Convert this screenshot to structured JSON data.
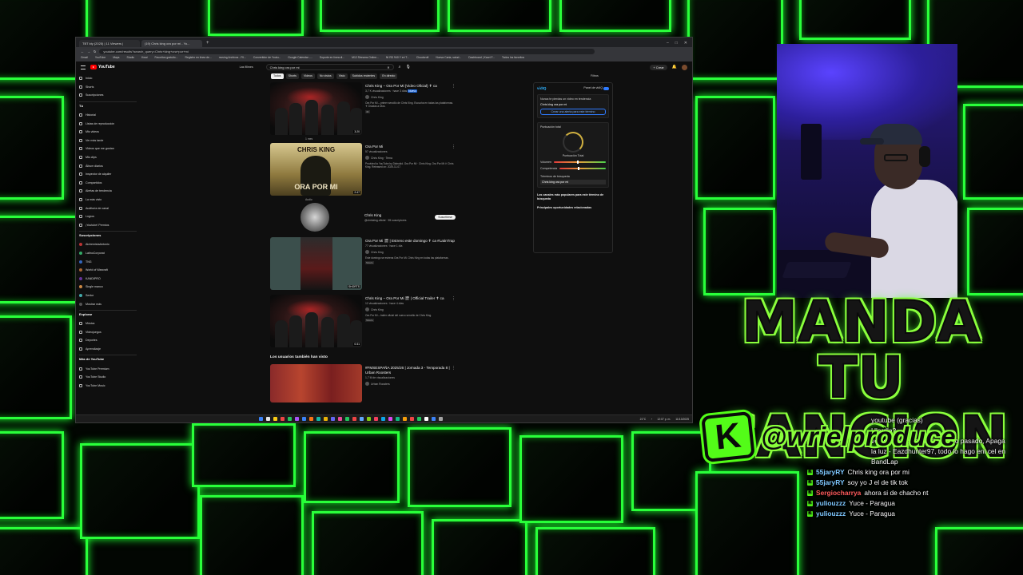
{
  "browser": {
    "tabs": [
      "TBT kty (2025) | 11 Viewers |",
      "(19) Chris king ora por mi - Yo..."
    ],
    "url": "youtube.com/results?search_query=Chris+king+ora+por+mi",
    "bookmarks": [
      "Gmail",
      "YouTube",
      "Maps",
      "Studio",
      "Kwai",
      "Favoritos gratuito...",
      "Registro en línea de...",
      "moving Archivos - Fil...",
      "Convertidor de Youtu...",
      "Google Calendar -...",
      "Soporte en línea di...",
      "M12 Streams Online...",
      "NI RD 940 Y eri T...",
      "Cloudcroft",
      "Nueva Carta, salud...",
      "Dashboard | Kaori F...",
      "Todos los favoritos"
    ]
  },
  "youtube": {
    "logo": "YouTube",
    "search_value": "Chris king ora por mi",
    "search_mode": "Las fillmes",
    "create": "+ Crear",
    "chips": [
      "Todos",
      "Shorts",
      "Videos",
      "No vistos",
      "Visto",
      "Subidos recientes",
      "En directo"
    ],
    "filters": "Filtros",
    "sidebar": {
      "main": [
        "Inicio",
        "Shorts",
        "Suscripciones"
      ],
      "you_header": "Tú",
      "you": [
        "Historial",
        "Listas de reproducción",
        "Mis videos",
        "Ver más tarde",
        "Videos que me gustan",
        "Mis clips",
        "Álbum diarios",
        "Inspector de alquiler",
        "Compartidos",
        "Alertas de tendencia",
        "La más visto",
        "Auditoría de canal",
        "Logros",
        "¡Youtube! Premios"
      ],
      "subs_header": "Suscripciones",
      "subs": [
        "AlchemistaAntonio",
        "LatinoCorporat",
        "TNG",
        "World of Warcraft",
        "KANDIPRO",
        "Single manco",
        "Senke",
        "Mostrar más"
      ],
      "explore_header": "Explorar",
      "explore": [
        "Música",
        "Videojuegos",
        "Deportes",
        "Aprendizaje"
      ],
      "more_header": "Más de YouTube",
      "more": [
        "YouTube Premium",
        "YouTube Studio",
        "YouTube Music"
      ]
    },
    "results": [
      {
        "title": "Chris King – Ora Por Mi (Video Oficial) ✝ ca",
        "meta": "3,7 K visualizaciones · hace 3 días",
        "new": "Nuevo",
        "channel": "Chris King",
        "desc": "Ora Por Mi – primer sencillo de Chris King. Escucha en todas las plataformas. ✝ Gracias a Dios.",
        "badge": "4K",
        "duration": "3:20",
        "under": "1 mes"
      },
      {
        "title": "Ora Por Mi",
        "meta": "57 visualizaciones",
        "channel": "Chris King · Tema",
        "desc": "Provided to YouTube by Distrokid. Ora Por Mi · Chris King. Ora Por Mi ℗ Chris King. Released on: 2025-11-07.",
        "duration": "2:47",
        "under": "Audio"
      },
      {
        "channel_name": "Chris King",
        "channel_meta": "@chrisking.oficial · 55 suscriptores",
        "subscribe": "Suscribirse"
      },
      {
        "title": "Ora Por Mi 🎬 | Estreno este domingo ✝ ca #LatinTrap",
        "meta": "77 visualizaciones · hace 1 día",
        "channel": "Chris King",
        "desc": "Este domingo se estrena Ora Por Mi. Chris King en todas las plataformas.",
        "badge": "Shorts",
        "duration": "SHORTS"
      },
      {
        "title": "Chris King – Ora Por Mi 🎬 | Official Trailer ✝ ca",
        "meta": "12 visualizaciones · hace 4 días",
        "channel": "Chris King",
        "desc": "Ora Por Mi – trailer oficial del nuevo sencillo de Chris King.",
        "badge": "Shorts",
        "duration": "0:31"
      }
    ],
    "section2": "Los usuarios también han visto",
    "result6": {
      "title": "#FMSESPAÑA 2025/26 | Jornada 3 - Temporada 8 | Urban Roosters",
      "meta": "1,7 M de visualizaciones",
      "channel": "Urban Roosters"
    }
  },
  "vidiq": {
    "logo": "vidIQ",
    "panel_label": "Panel de vidIQ",
    "trend_q": "Nunca te pierdas un video en tendencia",
    "keyword": "Chris king ora por mi",
    "alert_btn": "Crear una alerta para este término",
    "score_label": "Puntuación total",
    "score_center": "Puntuación Total",
    "volume": "Volumen",
    "competition": "Competencia",
    "terms_label": "Términos de búsqueda",
    "term_selected": "Chris king ora por mi",
    "popular": "Los canales más populares para este término de búsqueda",
    "opportunities": "Principales oportunidades relacionadas"
  },
  "taskbar": {
    "temp": "21°C",
    "time": "12:07 p. m.",
    "date": "11/13/2025"
  },
  "overlay": {
    "title_line1": "MANDA TU",
    "title_line2": "CANCION",
    "k_letter": "K",
    "handle": "@wrielproduce"
  },
  "chat": {
    "continued": [
      "youtube (gracias)",
      "Hlardla?"
    ],
    "continued_long": "voy empezando desde el año pasado, Apaga la luz - Eazdhunter97, todo lo hago eni cel en BandLap",
    "messages": [
      {
        "user": "55jaryRY",
        "color": "#7ec9ff",
        "text": "Chris king ora por mi"
      },
      {
        "user": "55jaryRY",
        "color": "#7ec9ff",
        "text": "soy yo J el de tik tok"
      },
      {
        "user": "Sergiocharrya",
        "color": "#ff5b5b",
        "text": "ahora si de chacho nt"
      },
      {
        "user": "yuliouzzz",
        "color": "#7ec9ff",
        "text": "Yuce - Paragua"
      },
      {
        "user": "yuliouzzz",
        "color": "#7ec9ff",
        "text": "Yuce - Paragua"
      }
    ]
  },
  "colors": {
    "neon": "#29ff3a",
    "kick_green": "#53fc18",
    "yt_red": "#ff0000"
  }
}
